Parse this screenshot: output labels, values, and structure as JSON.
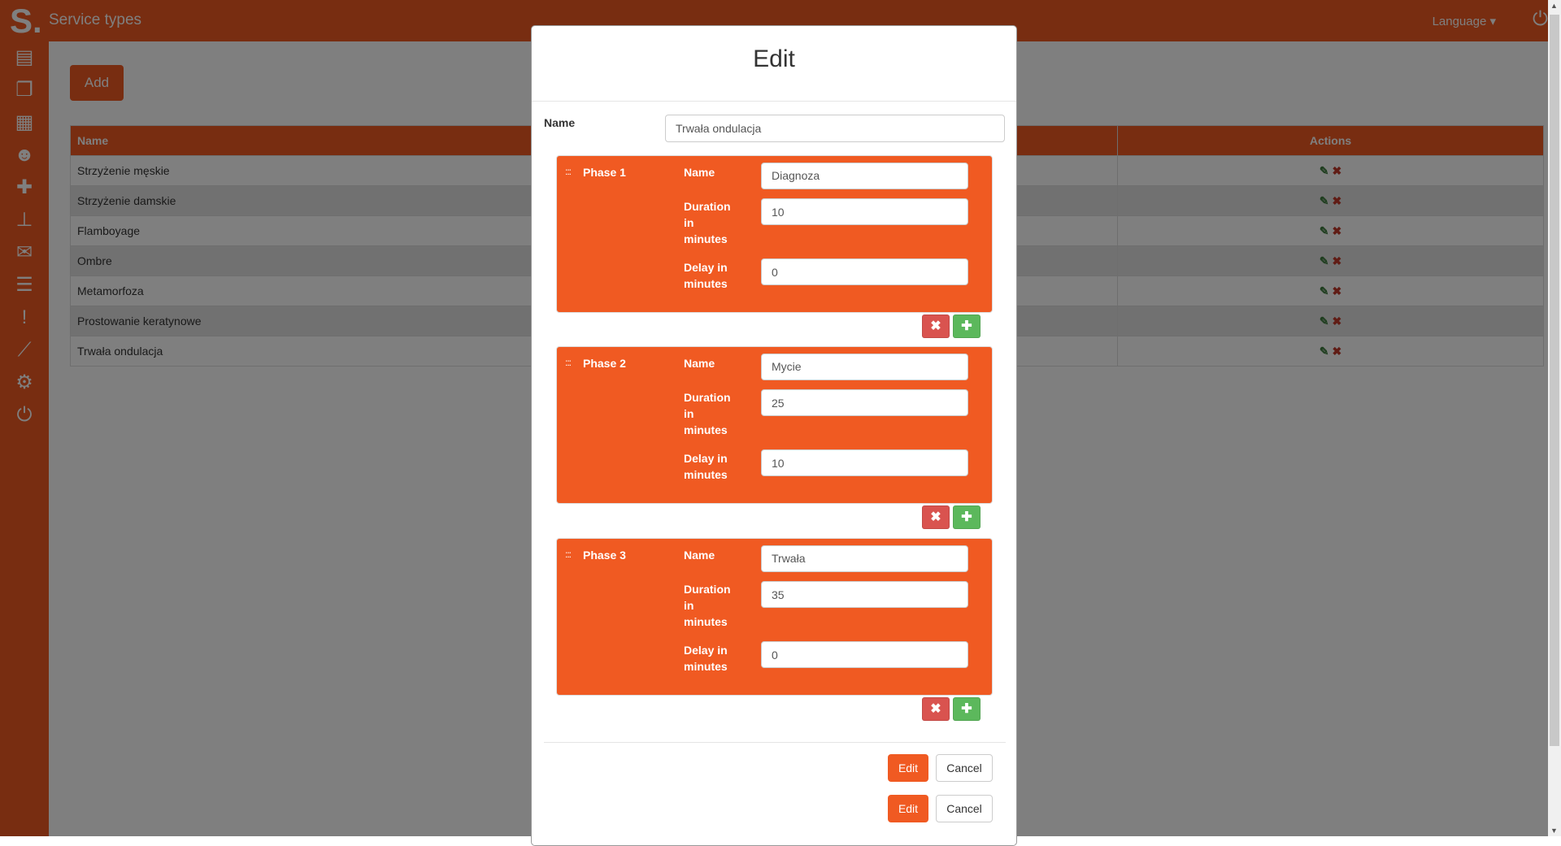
{
  "header": {
    "logo": "S.",
    "title": "Service types",
    "language": "Language ▾",
    "power_icon": "power-icon"
  },
  "sidebar": {
    "icons": [
      "newspaper-icon",
      "copy-icon",
      "calendar-icon",
      "users-icon",
      "puzzle-icon",
      "sitemap-icon",
      "envelope-icon",
      "database-icon",
      "exclamation-icon",
      "chart-line-icon",
      "cogs-icon",
      "power-icon"
    ]
  },
  "main": {
    "add_label": "Add",
    "table": {
      "columns": [
        "Name",
        "Actions"
      ],
      "rows": [
        "Strzyżenie męskie",
        "Strzyżenie damskie",
        "Flamboyage",
        "Ombre",
        "Metamorfoza",
        "Prostowanie keratynowe",
        "Trwała ondulacja"
      ]
    }
  },
  "modal": {
    "title": "Edit",
    "name_label": "Name",
    "name_value": "Trwała ondulacja",
    "field_labels": {
      "name": "Name",
      "duration": "Duration in minutes",
      "delay": "Delay in minutes"
    },
    "phases": [
      {
        "title": "Phase 1",
        "name": "Diagnoza",
        "duration": "10",
        "delay": "0"
      },
      {
        "title": "Phase 2",
        "name": "Mycie",
        "duration": "25",
        "delay": "10"
      },
      {
        "title": "Phase 3",
        "name": "Trwała",
        "duration": "35",
        "delay": "0"
      }
    ],
    "edit_label": "Edit",
    "cancel_label": "Cancel"
  },
  "colors": {
    "brand": "#f05a22",
    "danger": "#d9534f",
    "success": "#5cb85c"
  }
}
